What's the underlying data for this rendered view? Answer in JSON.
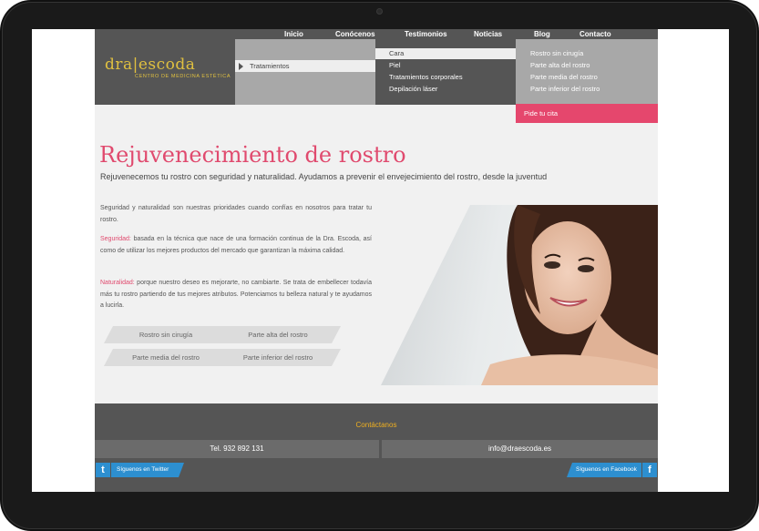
{
  "logo": {
    "brand": "dra|escoda",
    "tagline": "CENTRO DE MEDICINA ESTÉTICA"
  },
  "nav": {
    "items": [
      {
        "label": "Inicio"
      },
      {
        "label": "Conócenos"
      },
      {
        "label": "Testimonios"
      },
      {
        "label": "Noticias"
      },
      {
        "label": "Blog"
      },
      {
        "label": "Contacto"
      }
    ]
  },
  "menu": {
    "level1": "Tratamientos",
    "level2": [
      "Cara",
      "Piel",
      "Tratamientos corporales",
      "Depilación láser"
    ],
    "level3": [
      "Rostro sin cirugía",
      "Parte alta del rostro",
      "Parte media del rostro",
      "Parte inferior del rostro"
    ],
    "cta": "Pide tu cita"
  },
  "main": {
    "title": "Rejuvenecimiento de rostro",
    "subtitle": "Rejuvenecemos tu rostro con seguridad y naturalidad. Ayudamos a prevenir el envejecimiento del rostro, desde la juventud",
    "intro": "Seguridad y naturalidad son nuestras prioridades cuando confías en nosotros para tratar tu rostro.",
    "seguridad_label": "Seguridad:",
    "seguridad_text": " basada en la técnica que nace de una formación continua de la Dra. Escoda, así como de utilizar los mejores productos del mercado que garantizan la máxima calidad.",
    "naturalidad_label": "Naturalidad:",
    "naturalidad_text": " porque nuestro deseo es mejorarte, no cambiarte. Se trata de embellecer todavía más tu rostro partiendo de tus mejores atributos. Potenciamos tu belleza natural y te ayudamos a lucirla.",
    "buttons": [
      "Rostro sin cirugía",
      "Parte alta del rostro",
      "Parte media del rostro",
      "Parte inferior del rostro"
    ]
  },
  "footer": {
    "title": "Contáctanos",
    "phone": "Tel. 932 892 131",
    "email": "info@draescoda.es",
    "twitter": "Síguenos en Twitter",
    "facebook": "Síguenos en Facebook"
  },
  "colors": {
    "accent": "#e04a6e",
    "gold": "#e0c040",
    "dark": "#555555",
    "social": "#2d8fd0"
  }
}
